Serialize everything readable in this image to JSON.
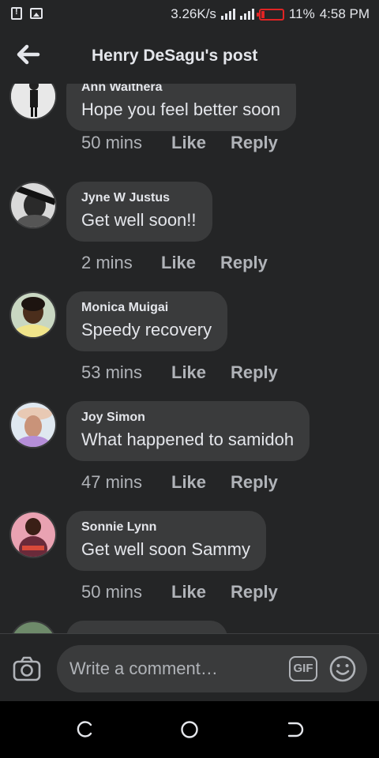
{
  "status_bar": {
    "speed": "3.26K/s",
    "battery": "11%",
    "time": "4:58 PM",
    "battery_color": "#e02424"
  },
  "header": {
    "title": "Henry DeSagu's post",
    "back_icon": "arrow-left-icon"
  },
  "comments": [
    {
      "author": "Ann Waithera",
      "text": "Hope you feel better soon",
      "time": "50 mins",
      "like": "Like",
      "reply": "Reply"
    },
    {
      "author": "Jyne W Justus",
      "text": "Get well soon!!",
      "time": "2 mins",
      "like": "Like",
      "reply": "Reply"
    },
    {
      "author": "Monica Muigai",
      "text": "Speedy recovery",
      "time": "53 mins",
      "like": "Like",
      "reply": "Reply"
    },
    {
      "author": "Joy Simon",
      "text": "What happened to samidoh",
      "time": "47 mins",
      "like": "Like",
      "reply": "Reply"
    },
    {
      "author": "Sonnie Lynn",
      "text": "Get well soon Sammy",
      "time": "50 mins",
      "like": "Like",
      "reply": "Reply"
    }
  ],
  "composer": {
    "placeholder": "Write a comment…",
    "gif_label": "GIF",
    "camera_icon": "camera-icon",
    "emoji_icon": "emoji-icon"
  },
  "colors": {
    "background": "#242526",
    "bubble": "#3a3b3c",
    "text": "#e4e6eb",
    "secondary_text": "#b0b3b8"
  }
}
